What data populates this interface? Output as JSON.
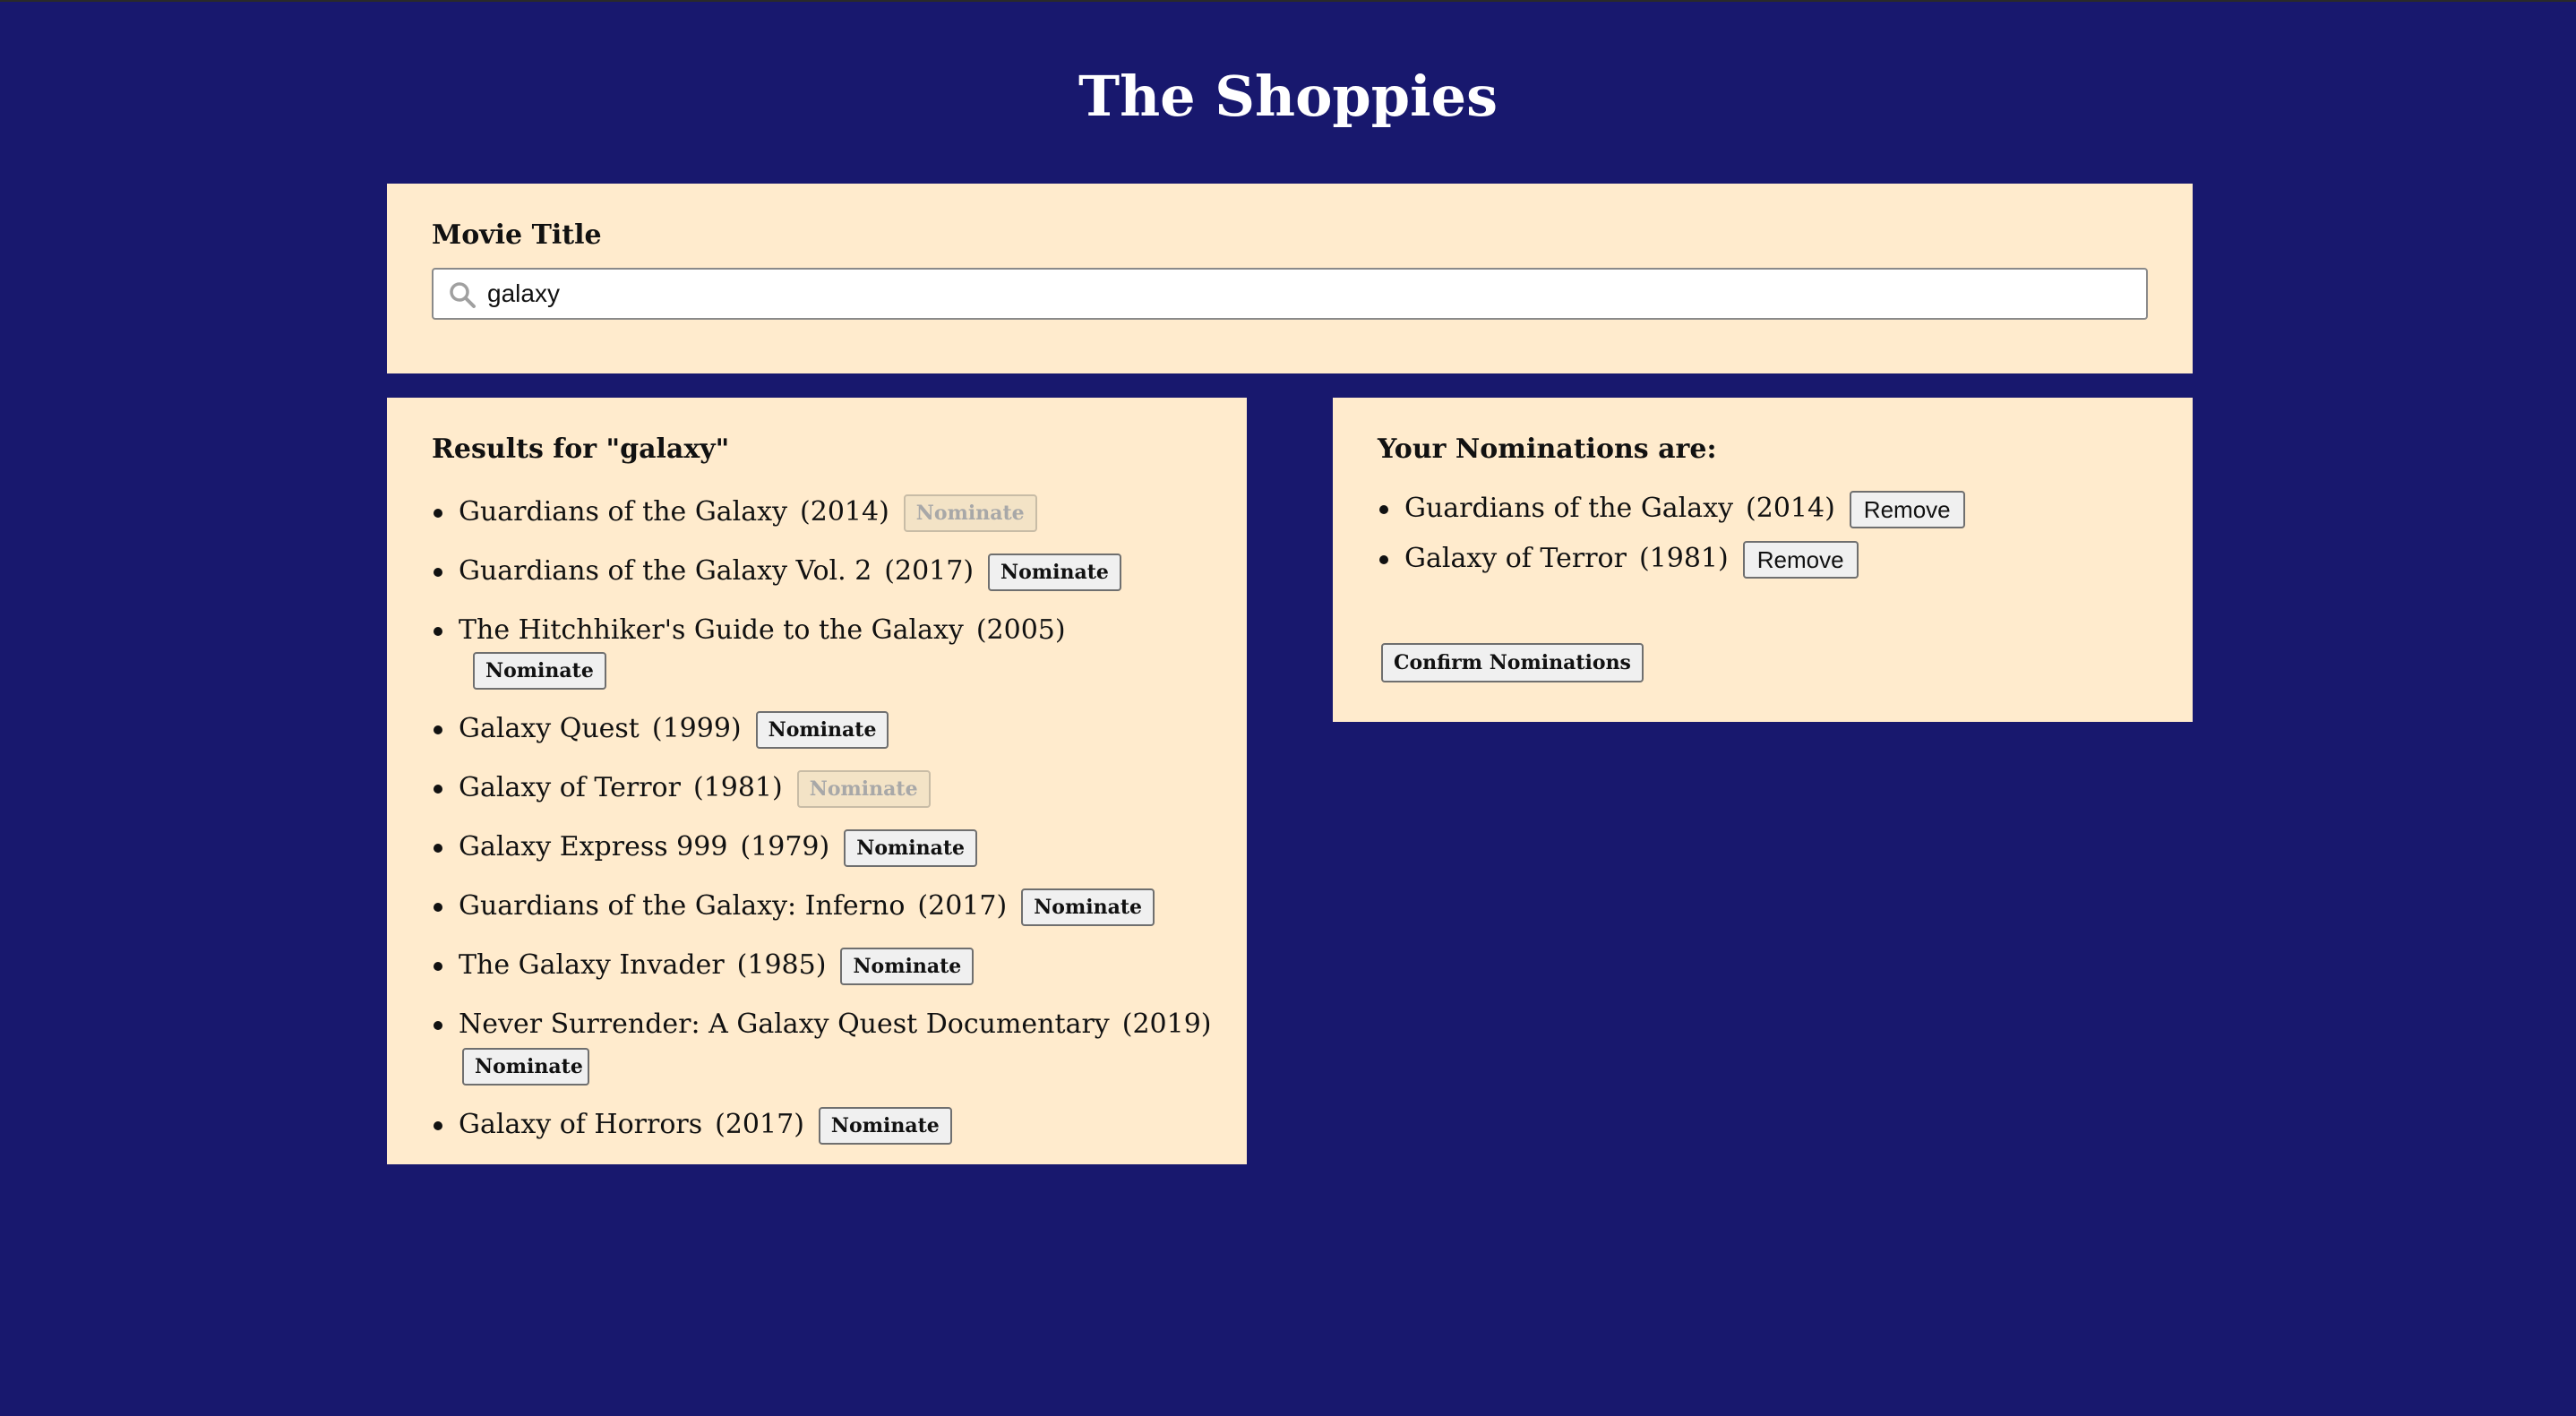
{
  "app": {
    "title": "The Shoppies"
  },
  "search": {
    "label": "Movie Title",
    "value": "galaxy",
    "icon": "search-icon"
  },
  "results": {
    "heading": "Results for \"galaxy\"",
    "nominate_label": "Nominate",
    "items": [
      {
        "title": "Guardians of the Galaxy",
        "year": "(2014)",
        "nominated": true
      },
      {
        "title": "Guardians of the Galaxy Vol. 2",
        "year": "(2017)",
        "nominated": false
      },
      {
        "title": "The Hitchhiker's Guide to the Galaxy",
        "year": "(2005)",
        "nominated": false
      },
      {
        "title": "Galaxy Quest",
        "year": "(1999)",
        "nominated": false
      },
      {
        "title": "Galaxy of Terror",
        "year": "(1981)",
        "nominated": true
      },
      {
        "title": "Galaxy Express 999",
        "year": "(1979)",
        "nominated": false
      },
      {
        "title": "Guardians of the Galaxy: Inferno",
        "year": "(2017)",
        "nominated": false
      },
      {
        "title": "The Galaxy Invader",
        "year": "(1985)",
        "nominated": false
      },
      {
        "title": "Never Surrender: A Galaxy Quest Documentary",
        "year": "(2019)",
        "nominated": false
      },
      {
        "title": "Galaxy of Horrors",
        "year": "(2017)",
        "nominated": false
      }
    ]
  },
  "nominations": {
    "heading": "Your Nominations are:",
    "remove_label": "Remove",
    "confirm_label": "Confirm Nominations",
    "items": [
      {
        "title": "Guardians of the Galaxy",
        "year": "(2014)"
      },
      {
        "title": "Galaxy of Terror",
        "year": "(1981)"
      }
    ]
  },
  "colors": {
    "background": "#18186e",
    "panel": "#ffebcd",
    "title_text": "#ffffff"
  }
}
